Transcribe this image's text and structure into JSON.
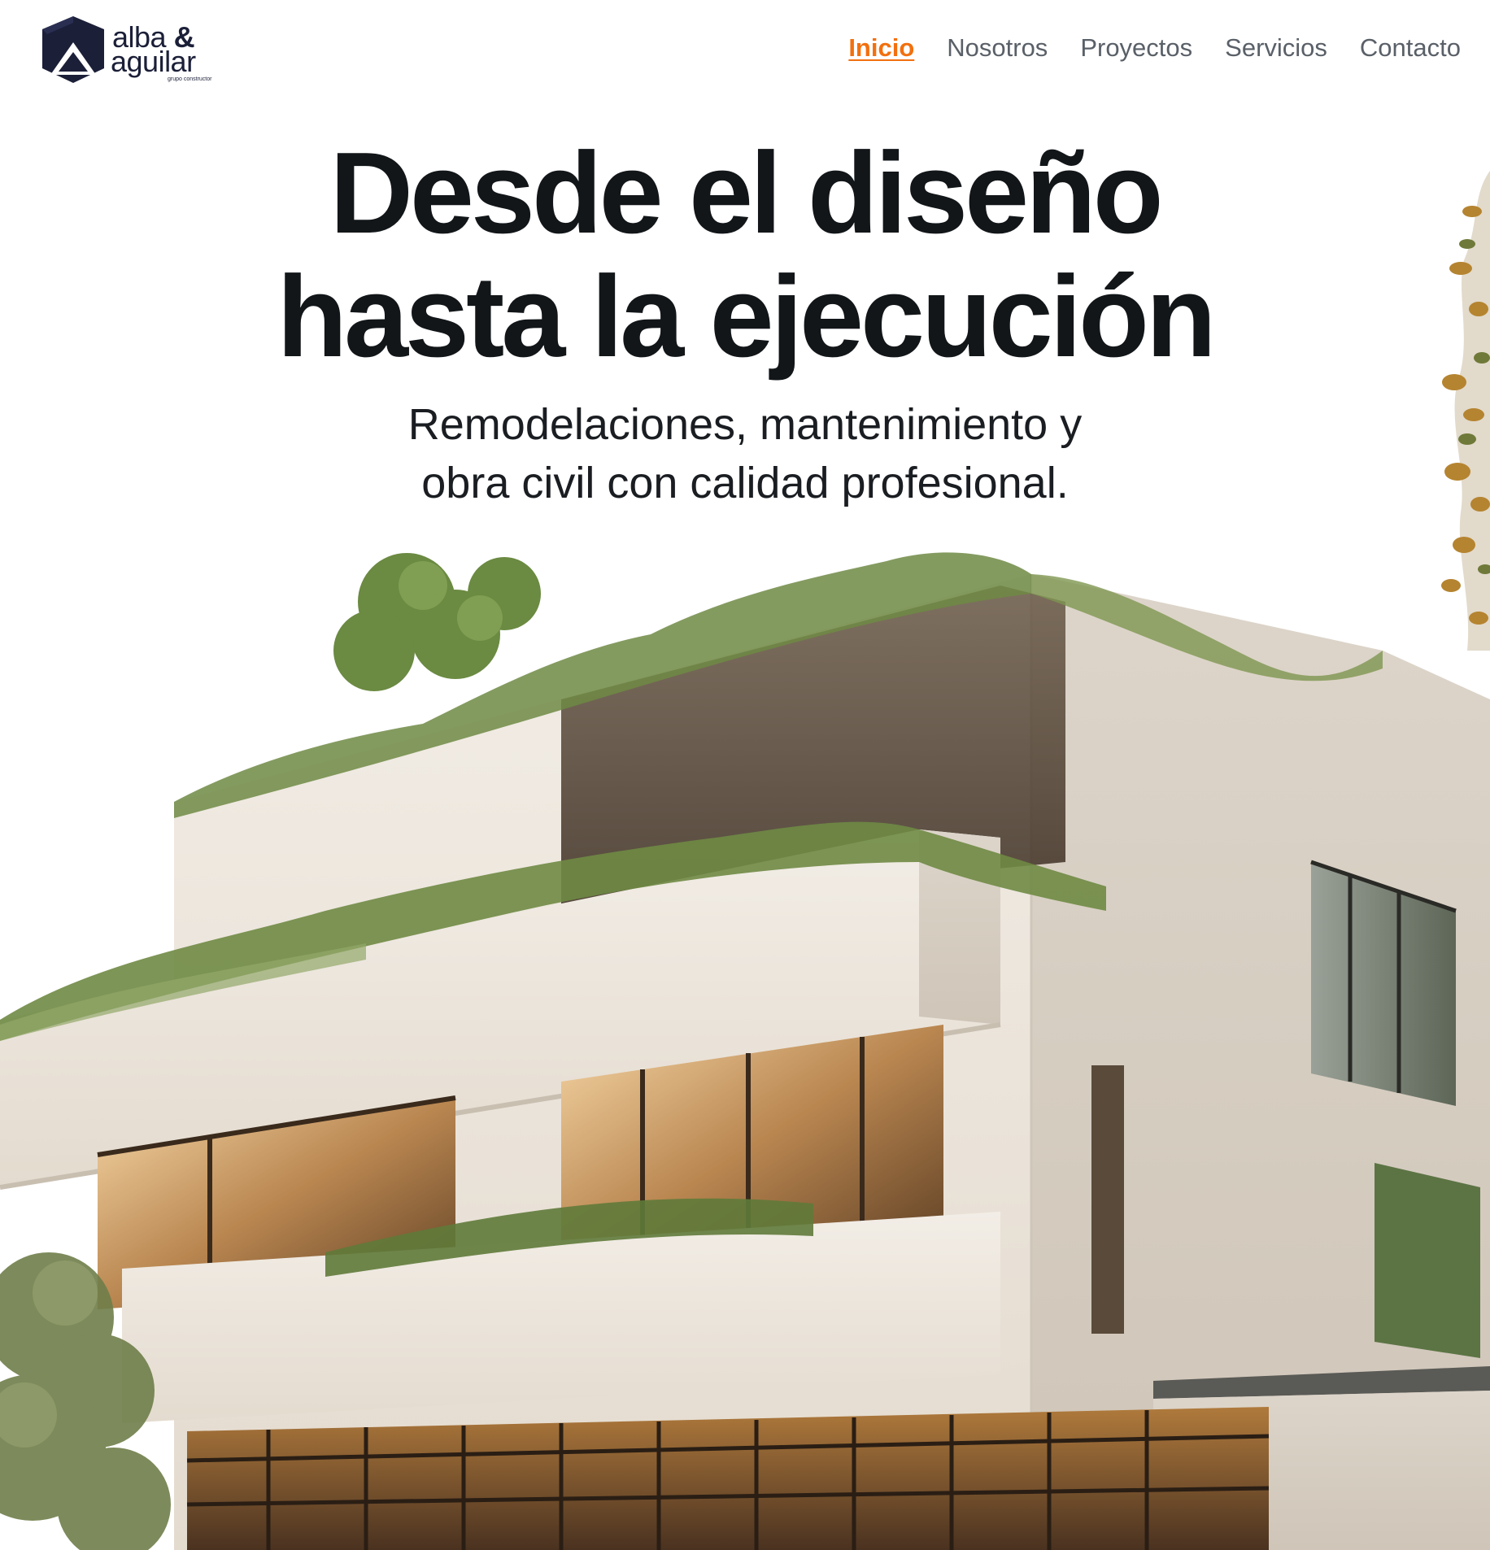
{
  "brand": {
    "name_line1": "alba",
    "ampersand": "&",
    "name_line2": "aguilar",
    "tagline": "grupo constructor"
  },
  "nav": {
    "items": [
      {
        "label": "Inicio",
        "active": true
      },
      {
        "label": "Nosotros",
        "active": false
      },
      {
        "label": "Proyectos",
        "active": false
      },
      {
        "label": "Servicios",
        "active": false
      },
      {
        "label": "Contacto",
        "active": false
      }
    ]
  },
  "hero": {
    "title_line1": "Desde el diseño",
    "title_line2": "hasta la ejecución",
    "subtitle_line1": "Remodelaciones, mantenimiento y",
    "subtitle_line2": "obra civil con calidad profesional."
  },
  "colors": {
    "accent": "#f2700f",
    "nav_text": "#5a6068",
    "title": "#121619",
    "logo": "#1b1f38"
  },
  "icons": {
    "logo_mark": "hexagon-house-logo"
  }
}
